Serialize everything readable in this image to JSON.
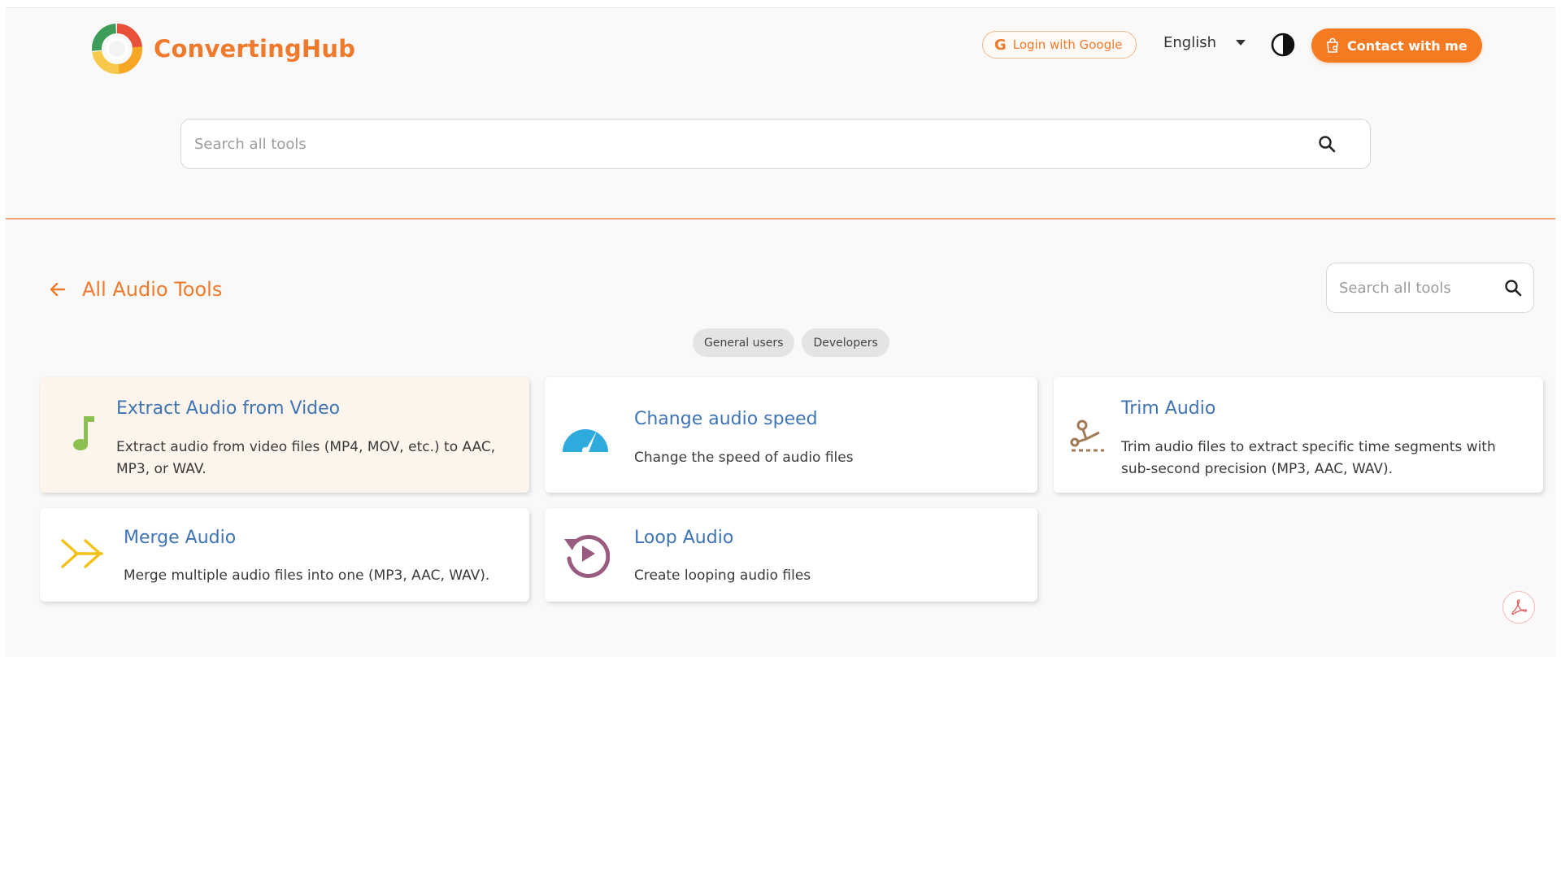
{
  "brand": {
    "name": "ConvertingHub"
  },
  "header": {
    "login_label": "Login with Google",
    "language": "English",
    "contact_label": "Contact with me"
  },
  "search": {
    "placeholder": "Search all tools"
  },
  "section": {
    "title": "All Audio Tools",
    "search_placeholder": "Search all tools"
  },
  "filters": [
    "General users",
    "Developers"
  ],
  "tools": [
    {
      "title": "Extract Audio from Video",
      "description": "Extract audio from video files (MP4, MOV, etc.) to AAC, MP3, or WAV.",
      "icon": "music-note-icon",
      "color": "#8bbf4f"
    },
    {
      "title": "Change audio speed",
      "description": "Change the speed of audio files",
      "icon": "speedometer-icon",
      "color": "#2eaadc"
    },
    {
      "title": "Trim Audio",
      "description": "Trim audio files to extract specific time segments with sub-second precision (MP3, AAC, WAV).",
      "icon": "scissors-icon",
      "color": "#a07a55"
    },
    {
      "title": "Merge Audio",
      "description": "Merge multiple audio files into one (MP3, AAC, WAV).",
      "icon": "merge-arrows-icon",
      "color": "#f2c21b"
    },
    {
      "title": "Loop Audio",
      "description": "Create looping audio files",
      "icon": "loop-play-icon",
      "color": "#9a5b80"
    }
  ],
  "colors": {
    "accent": "#f57a22",
    "link": "#3f74b5",
    "active_card": "#fdf5ec"
  }
}
